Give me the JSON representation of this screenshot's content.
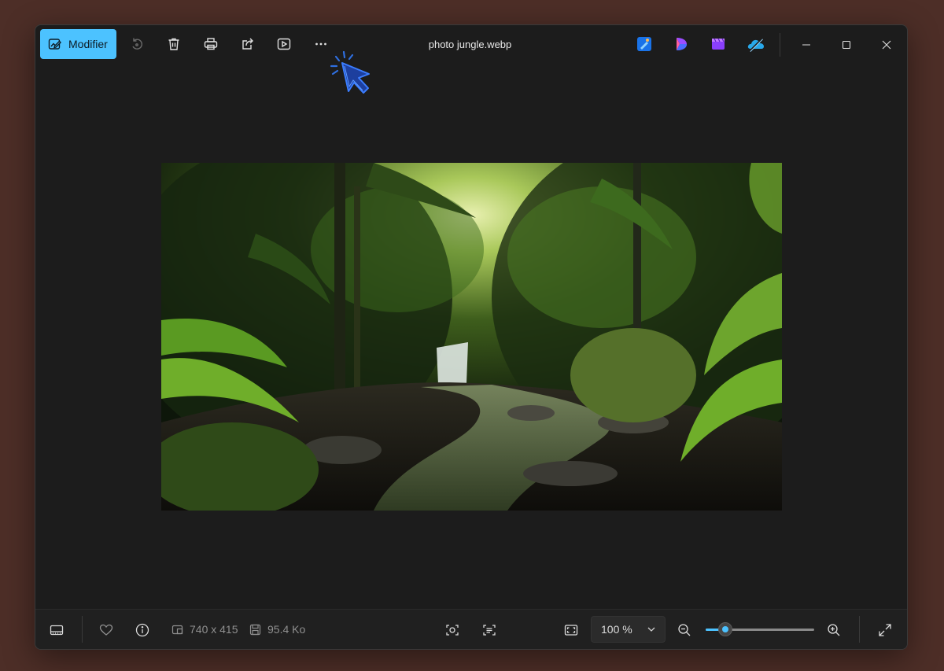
{
  "titlebar": {
    "edit_label": "Modifier",
    "file_name": "photo jungle.webp"
  },
  "toolbar_icons": [
    "edit-image-icon",
    "rotate-icon",
    "delete-icon",
    "print-icon",
    "share-icon",
    "slideshow-icon",
    "more-icon"
  ],
  "app_icons": [
    "designer-icon",
    "clipchamp-icon",
    "video-editor-icon",
    "onedrive-icon"
  ],
  "window_controls": [
    "minimize-icon",
    "maximize-icon",
    "close-icon"
  ],
  "info": {
    "dimensions": "740 x 415",
    "file_size": "95.4 Ko"
  },
  "zoom": {
    "value": "100 %",
    "slider_level": 0.18
  },
  "colors": {
    "accent": "#4cc2ff",
    "window_bg": "#1c1c1c",
    "desktop_bg": "#4d2e27"
  }
}
